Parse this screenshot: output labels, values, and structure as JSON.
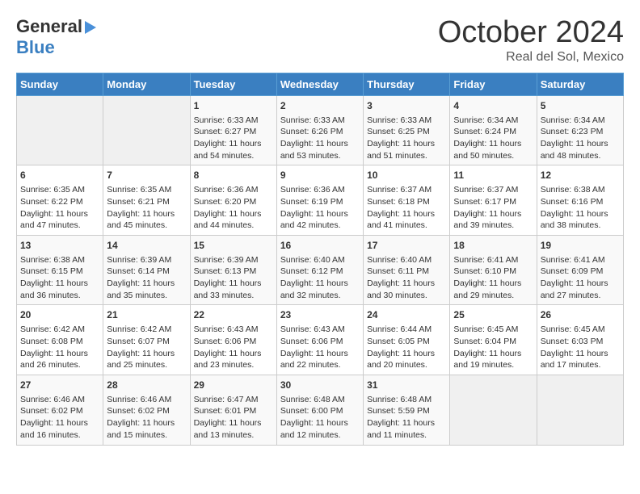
{
  "header": {
    "logo_line1": "General",
    "logo_line2": "Blue",
    "month": "October 2024",
    "location": "Real del Sol, Mexico"
  },
  "weekdays": [
    "Sunday",
    "Monday",
    "Tuesday",
    "Wednesday",
    "Thursday",
    "Friday",
    "Saturday"
  ],
  "weeks": [
    [
      {
        "day": "",
        "content": ""
      },
      {
        "day": "",
        "content": ""
      },
      {
        "day": "1",
        "content": "Sunrise: 6:33 AM\nSunset: 6:27 PM\nDaylight: 11 hours and 54 minutes."
      },
      {
        "day": "2",
        "content": "Sunrise: 6:33 AM\nSunset: 6:26 PM\nDaylight: 11 hours and 53 minutes."
      },
      {
        "day": "3",
        "content": "Sunrise: 6:33 AM\nSunset: 6:25 PM\nDaylight: 11 hours and 51 minutes."
      },
      {
        "day": "4",
        "content": "Sunrise: 6:34 AM\nSunset: 6:24 PM\nDaylight: 11 hours and 50 minutes."
      },
      {
        "day": "5",
        "content": "Sunrise: 6:34 AM\nSunset: 6:23 PM\nDaylight: 11 hours and 48 minutes."
      }
    ],
    [
      {
        "day": "6",
        "content": "Sunrise: 6:35 AM\nSunset: 6:22 PM\nDaylight: 11 hours and 47 minutes."
      },
      {
        "day": "7",
        "content": "Sunrise: 6:35 AM\nSunset: 6:21 PM\nDaylight: 11 hours and 45 minutes."
      },
      {
        "day": "8",
        "content": "Sunrise: 6:36 AM\nSunset: 6:20 PM\nDaylight: 11 hours and 44 minutes."
      },
      {
        "day": "9",
        "content": "Sunrise: 6:36 AM\nSunset: 6:19 PM\nDaylight: 11 hours and 42 minutes."
      },
      {
        "day": "10",
        "content": "Sunrise: 6:37 AM\nSunset: 6:18 PM\nDaylight: 11 hours and 41 minutes."
      },
      {
        "day": "11",
        "content": "Sunrise: 6:37 AM\nSunset: 6:17 PM\nDaylight: 11 hours and 39 minutes."
      },
      {
        "day": "12",
        "content": "Sunrise: 6:38 AM\nSunset: 6:16 PM\nDaylight: 11 hours and 38 minutes."
      }
    ],
    [
      {
        "day": "13",
        "content": "Sunrise: 6:38 AM\nSunset: 6:15 PM\nDaylight: 11 hours and 36 minutes."
      },
      {
        "day": "14",
        "content": "Sunrise: 6:39 AM\nSunset: 6:14 PM\nDaylight: 11 hours and 35 minutes."
      },
      {
        "day": "15",
        "content": "Sunrise: 6:39 AM\nSunset: 6:13 PM\nDaylight: 11 hours and 33 minutes."
      },
      {
        "day": "16",
        "content": "Sunrise: 6:40 AM\nSunset: 6:12 PM\nDaylight: 11 hours and 32 minutes."
      },
      {
        "day": "17",
        "content": "Sunrise: 6:40 AM\nSunset: 6:11 PM\nDaylight: 11 hours and 30 minutes."
      },
      {
        "day": "18",
        "content": "Sunrise: 6:41 AM\nSunset: 6:10 PM\nDaylight: 11 hours and 29 minutes."
      },
      {
        "day": "19",
        "content": "Sunrise: 6:41 AM\nSunset: 6:09 PM\nDaylight: 11 hours and 27 minutes."
      }
    ],
    [
      {
        "day": "20",
        "content": "Sunrise: 6:42 AM\nSunset: 6:08 PM\nDaylight: 11 hours and 26 minutes."
      },
      {
        "day": "21",
        "content": "Sunrise: 6:42 AM\nSunset: 6:07 PM\nDaylight: 11 hours and 25 minutes."
      },
      {
        "day": "22",
        "content": "Sunrise: 6:43 AM\nSunset: 6:06 PM\nDaylight: 11 hours and 23 minutes."
      },
      {
        "day": "23",
        "content": "Sunrise: 6:43 AM\nSunset: 6:06 PM\nDaylight: 11 hours and 22 minutes."
      },
      {
        "day": "24",
        "content": "Sunrise: 6:44 AM\nSunset: 6:05 PM\nDaylight: 11 hours and 20 minutes."
      },
      {
        "day": "25",
        "content": "Sunrise: 6:45 AM\nSunset: 6:04 PM\nDaylight: 11 hours and 19 minutes."
      },
      {
        "day": "26",
        "content": "Sunrise: 6:45 AM\nSunset: 6:03 PM\nDaylight: 11 hours and 17 minutes."
      }
    ],
    [
      {
        "day": "27",
        "content": "Sunrise: 6:46 AM\nSunset: 6:02 PM\nDaylight: 11 hours and 16 minutes."
      },
      {
        "day": "28",
        "content": "Sunrise: 6:46 AM\nSunset: 6:02 PM\nDaylight: 11 hours and 15 minutes."
      },
      {
        "day": "29",
        "content": "Sunrise: 6:47 AM\nSunset: 6:01 PM\nDaylight: 11 hours and 13 minutes."
      },
      {
        "day": "30",
        "content": "Sunrise: 6:48 AM\nSunset: 6:00 PM\nDaylight: 11 hours and 12 minutes."
      },
      {
        "day": "31",
        "content": "Sunrise: 6:48 AM\nSunset: 5:59 PM\nDaylight: 11 hours and 11 minutes."
      },
      {
        "day": "",
        "content": ""
      },
      {
        "day": "",
        "content": ""
      }
    ]
  ]
}
